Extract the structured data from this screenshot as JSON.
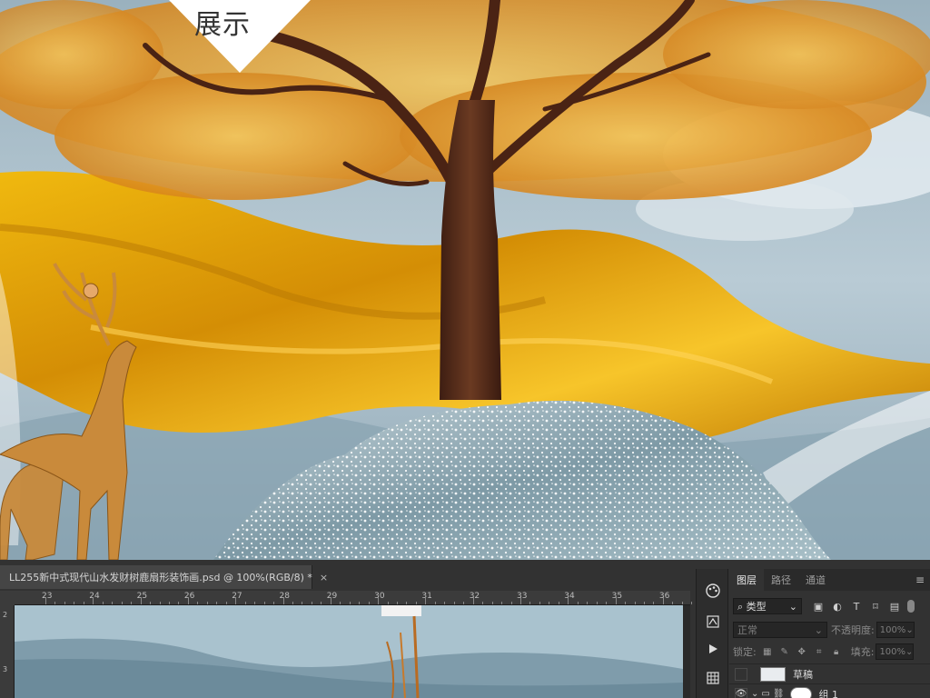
{
  "preview": {
    "badge_text": "展示"
  },
  "document_tab": {
    "title": "LL255新中式现代山水发财树鹿扇形装饰画.psd @ 100%(RGB/8) *",
    "close_glyph": "×"
  },
  "ruler": {
    "marks": [
      "23",
      "24",
      "25",
      "26",
      "27",
      "28",
      "29",
      "30",
      "31",
      "32",
      "33",
      "34",
      "35",
      "36"
    ],
    "vertical_marks": [
      "2",
      "3"
    ]
  },
  "layers_panel": {
    "tabs": [
      {
        "label": "图层",
        "active": true
      },
      {
        "label": "路径",
        "active": false
      },
      {
        "label": "通道",
        "active": false
      }
    ],
    "filter": {
      "label": "类型"
    },
    "blend_mode": "正常",
    "opacity_label": "不透明度:",
    "opacity_value": "100%",
    "lock_label": "锁定:",
    "fill_label": "填充:",
    "fill_value": "100%",
    "layers": [
      {
        "name": "草稿",
        "visible": false
      },
      {
        "name": "组 1",
        "visible": true,
        "is_group": true
      }
    ]
  },
  "colors": {
    "sky": "#9fb6c4",
    "silk": "#e1a50c",
    "leaves": "#f1b23a",
    "trunk": "#5a2f1c",
    "deer": "#c98a3b",
    "ps_background": "#323232"
  },
  "icons": {
    "strip": [
      "palette-icon",
      "adjustment-icon",
      "play-icon",
      "grid-icon"
    ],
    "filter": [
      "image-filter-icon",
      "adjustment-filter-icon",
      "type-filter-icon",
      "shape-filter-icon",
      "smart-object-filter-icon"
    ],
    "lock": [
      "lock-transparent-icon",
      "lock-paint-icon",
      "lock-move-icon",
      "lock-artboard-icon",
      "lock-all-icon"
    ]
  }
}
